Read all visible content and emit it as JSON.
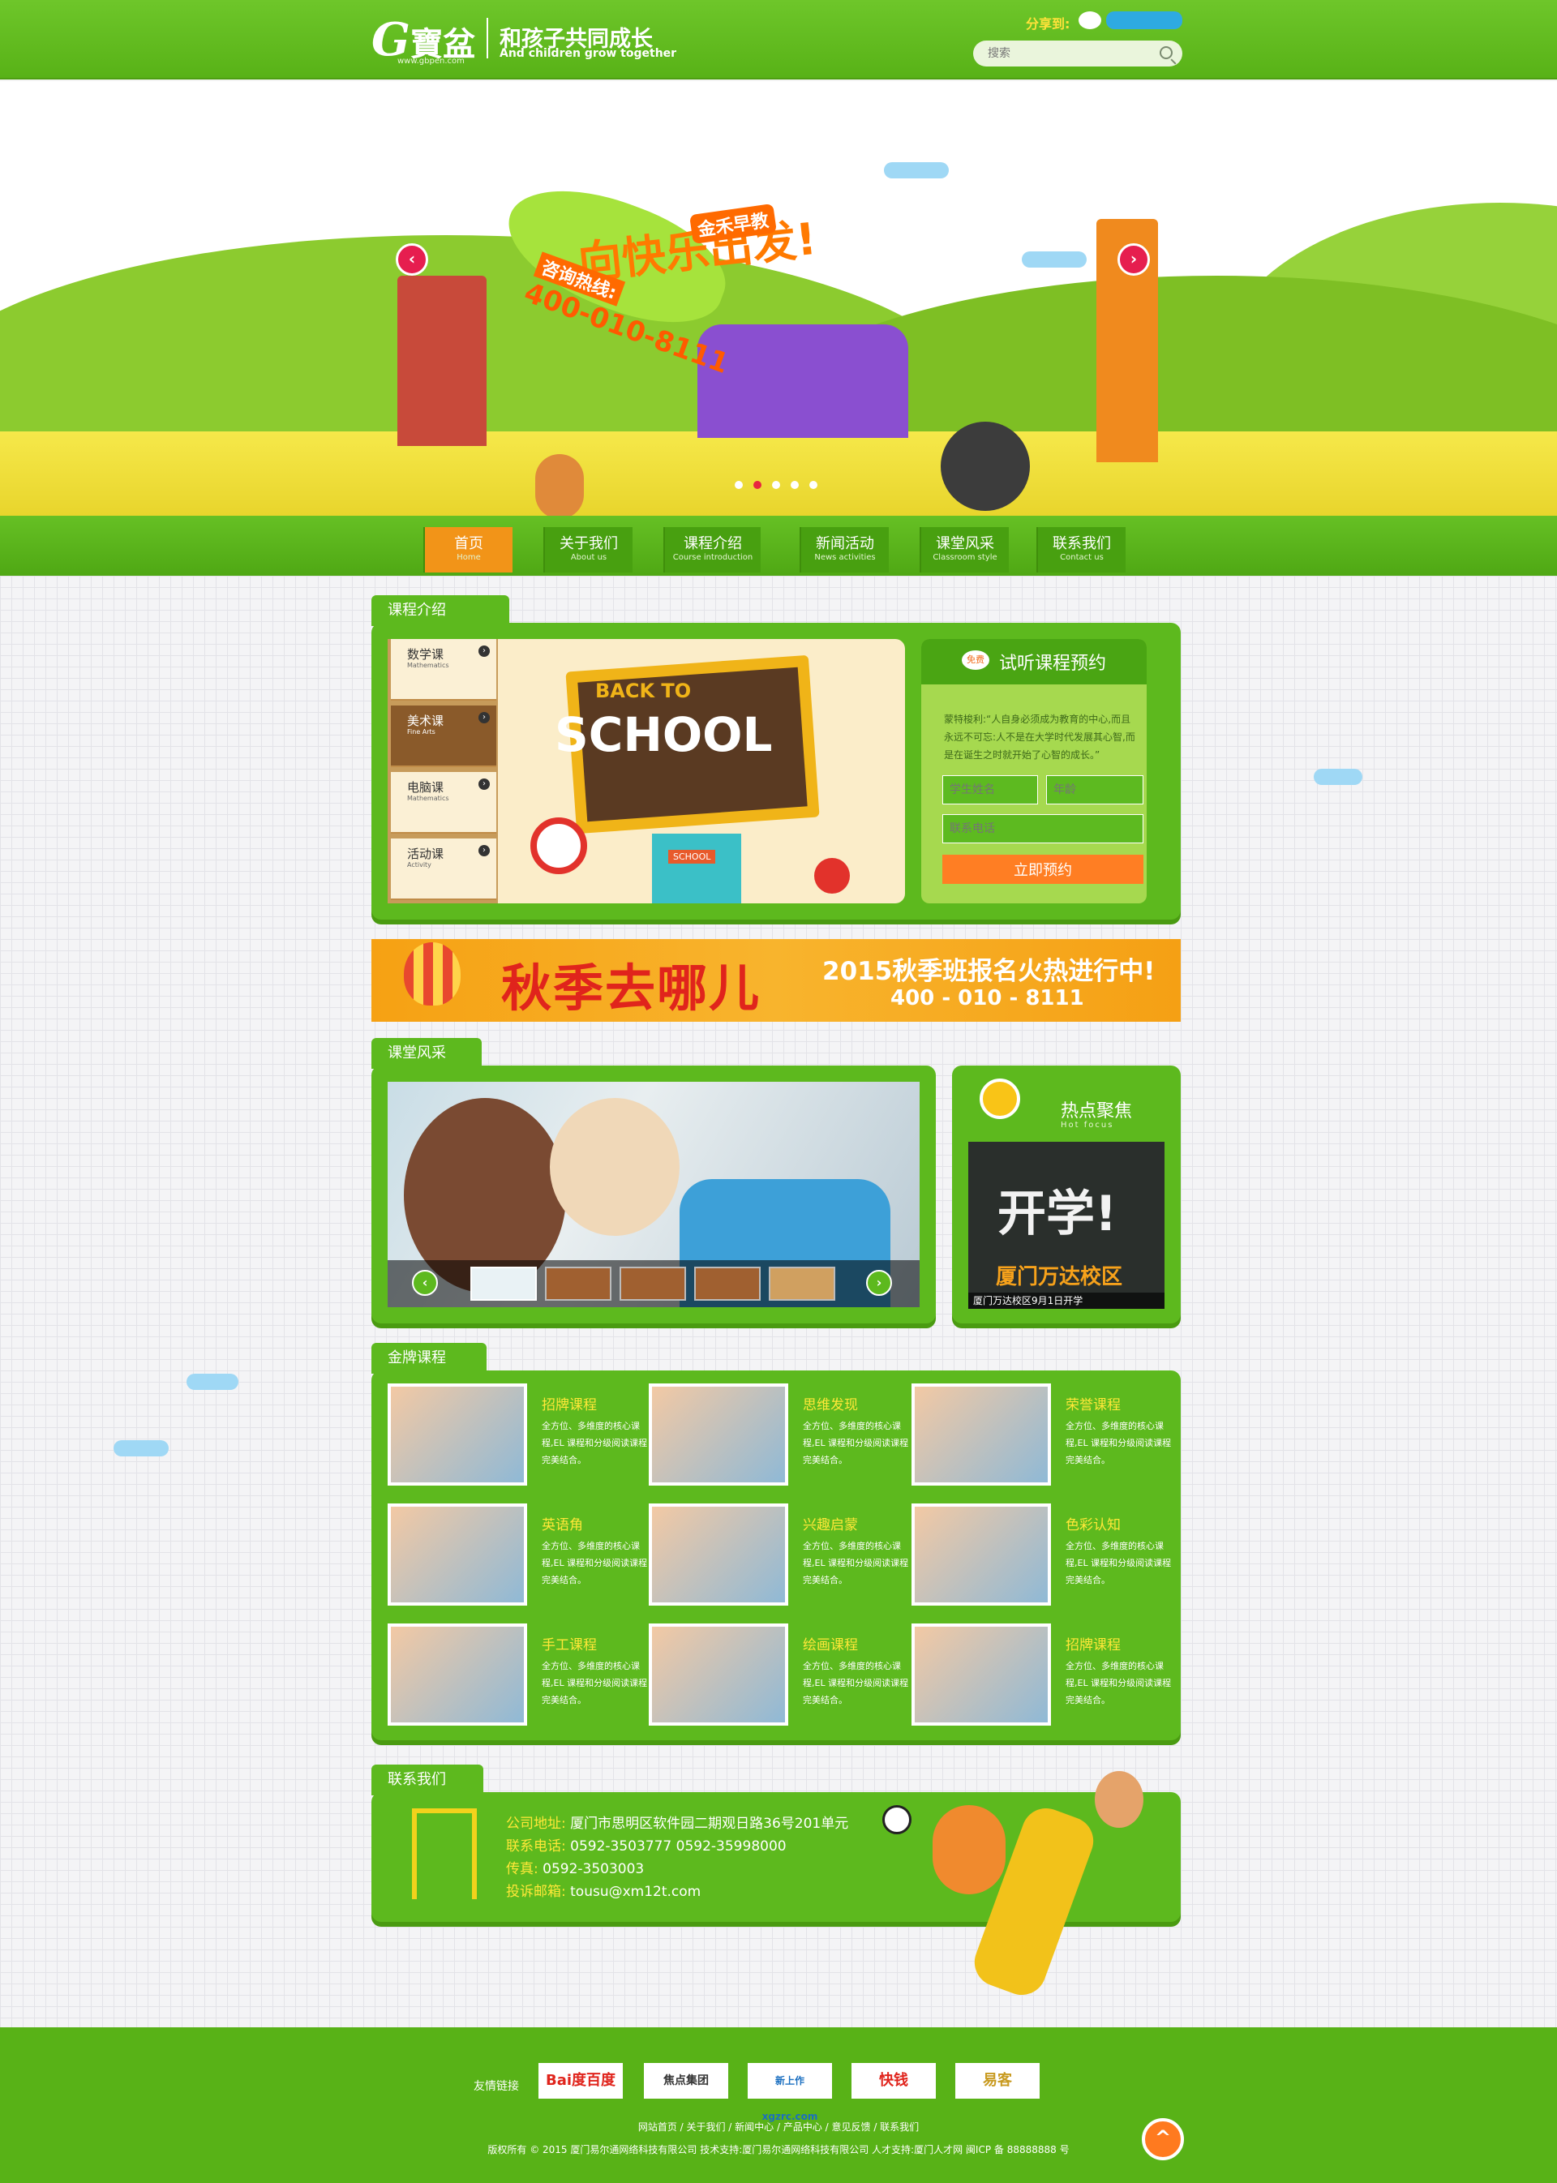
{
  "header": {
    "logo_g": "G",
    "logo_cn": "寶盆",
    "logo_url": "www.gbpen.com",
    "slogan_cn": "和孩子共同成长",
    "slogan_en": "And children grow together",
    "share_label": "分享到:",
    "search_placeholder": "搜索"
  },
  "banner": {
    "title": "向快乐出发!",
    "brand": "金禾早教",
    "hotline_label": "咨询热线:",
    "phone": "400-010-8111",
    "prev": "‹",
    "next": "›",
    "slide_count": 5,
    "active_slide": 2
  },
  "nav": {
    "items": [
      {
        "cn": "首页",
        "en": "Home",
        "active": true
      },
      {
        "cn": "关于我们",
        "en": "About us"
      },
      {
        "cn": "课程介绍",
        "en": "Course introduction"
      },
      {
        "cn": "新闻活动",
        "en": "News activities"
      },
      {
        "cn": "课堂风采",
        "en": "Classroom style"
      },
      {
        "cn": "联系我们",
        "en": "Contact us"
      }
    ]
  },
  "course": {
    "tab": "课程介绍",
    "menu": [
      {
        "cn": "数学课",
        "en": "Mathematics"
      },
      {
        "cn": "美术课",
        "en": "Fine Arts"
      },
      {
        "cn": "电脑课",
        "en": "Mathematics"
      },
      {
        "cn": "活动课",
        "en": "Activity"
      }
    ],
    "board_line1": "BACK TO",
    "board_line2": "SCHOOL",
    "school_sign": "SCHOOL"
  },
  "booking": {
    "badge": "免费",
    "title": "试听课程预约",
    "quote": "蒙特梭利:“人自身必须成为教育的中心,而且永远不可忘:人不是在大学时代发展其心智,而是在诞生之时就开始了心智的成长。”",
    "name_placeholder": "学生姓名",
    "age_placeholder": "年龄",
    "phone_placeholder": "联系电话",
    "submit": "立即预约"
  },
  "promo": {
    "big": "秋季去哪儿",
    "sub": "2015秋季班报名火热进行中!",
    "phone": "400 - 010 - 8111"
  },
  "classroom": {
    "tab": "课堂风采",
    "prev": "‹",
    "next": "›"
  },
  "hot": {
    "title": "热点聚焦",
    "en": "Hot focus",
    "big": "开学!",
    "campus": "厦门万达校区",
    "caption": "厦门万达校区9月1日开学"
  },
  "gold": {
    "tab": "金牌课程",
    "items": [
      {
        "title": "招牌课程",
        "desc": "全方位、多维度的核心课程,EL 课程和分级阅读课程完美结合。"
      },
      {
        "title": "思维发现",
        "desc": "全方位、多维度的核心课程,EL 课程和分级阅读课程完美结合。"
      },
      {
        "title": "荣誉课程",
        "desc": "全方位、多维度的核心课程,EL 课程和分级阅读课程完美结合。"
      },
      {
        "title": "英语角",
        "desc": "全方位、多维度的核心课程,EL 课程和分级阅读课程完美结合。"
      },
      {
        "title": "兴趣启蒙",
        "desc": "全方位、多维度的核心课程,EL 课程和分级阅读课程完美结合。"
      },
      {
        "title": "色彩认知",
        "desc": "全方位、多维度的核心课程,EL 课程和分级阅读课程完美结合。"
      },
      {
        "title": "手工课程",
        "desc": "全方位、多维度的核心课程,EL 课程和分级阅读课程完美结合。"
      },
      {
        "title": "绘画课程",
        "desc": "全方位、多维度的核心课程,EL 课程和分级阅读课程完美结合。"
      },
      {
        "title": "招牌课程",
        "desc": "全方位、多维度的核心课程,EL 课程和分级阅读课程完美结合。"
      }
    ]
  },
  "contact": {
    "tab": "联系我们",
    "address_label": "公司地址:",
    "address": "厦门市思明区软件园二期观日路36号201单元",
    "phone_label": "联系电话:",
    "phone": "0592-3503777    0592-35998000",
    "fax_label": "传真:",
    "fax": "0592-3503003",
    "email_label": "投诉邮箱:",
    "email": "tousu@xm12t.com"
  },
  "footer": {
    "links_label": "友情链接",
    "partners": [
      "Bai度百度",
      "焦点集团",
      "新上作 xgzrc.com",
      "快钱",
      "易客"
    ],
    "nav_links": "网站首页 / 关于我们 / 新闻中心 / 产品中心 / 意见反馈 / 联系我们",
    "copyright": "版权所有 © 2015 厦门易尔通网络科技有限公司      技术支持:厦门易尔通网络科技有限公司      人才支持:厦门人才网 闽ICP 备 88888888 号",
    "to_top": "^"
  },
  "colors": {
    "brand_green": "#5db91e",
    "accent_orange": "#ff7e23",
    "title_yellow": "#ffe838"
  }
}
